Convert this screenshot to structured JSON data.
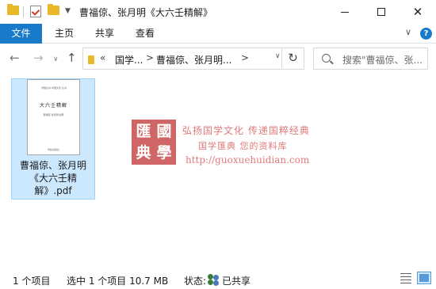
{
  "window": {
    "title": "曹福倞、张月明《大六壬精解》",
    "minimize_icon": "minimize-icon",
    "maximize_icon": "maximize-icon",
    "close_symbol": "✕"
  },
  "ribbon": {
    "tabs": [
      "文件",
      "主页",
      "共享",
      "查看"
    ],
    "expand_symbol": "∨",
    "help_symbol": "?"
  },
  "nav": {
    "back_symbol": "←",
    "forward_symbol": "→",
    "recent_symbol": "∨",
    "up_symbol": "↑",
    "address": {
      "overflow": "«",
      "segments": [
        "国学...",
        "曹福倞、张月明..."
      ],
      "separator": ">",
      "dropdown_symbol": "∨"
    },
    "refresh_symbol": "↻",
    "search_placeholder": "搜索\"曹福倞、张..."
  },
  "file": {
    "name": "曹福倞、张月明《大六壬精解》.pdf",
    "thumbnail": {
      "header": "术数丛书·中国文化·丛书",
      "title": "大六壬精解",
      "authors": "曹福倞 张月明 编著",
      "publisher": "华龄出版社"
    }
  },
  "watermark": {
    "seal_chars": [
      "匯",
      "國",
      "典",
      "學"
    ],
    "line1": "弘扬国学文化  传递国粹经典",
    "line2": "国学匯典 您的资料库",
    "url": "http://guoxuehuidian.com"
  },
  "status": {
    "item_count": "1 个项目",
    "selection": "选中 1 个项目  10.7 MB",
    "state_label": "状态:",
    "state_value": "已共享",
    "view_details_icon": "details-view-icon",
    "view_large_icon": "large-icons-view-icon"
  },
  "colors": {
    "accent": "#1979ca",
    "selection_bg": "#cce8ff",
    "folder": "#e8b828",
    "seal": "#c43a3a"
  }
}
